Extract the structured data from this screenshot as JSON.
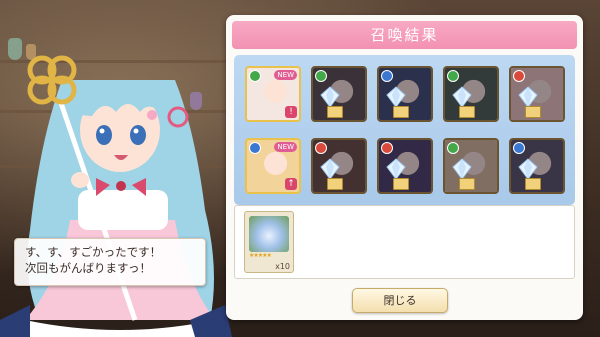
{
  "dialog": {
    "title": "召喚結果",
    "close_label": "閉じる"
  },
  "speech": {
    "line1": "す、す、すごかったです！",
    "line2": "次回もがんばりますっ！"
  },
  "results": [
    {
      "element": "wind",
      "elem_color": "#43a84a",
      "new": "NEW",
      "rare": true,
      "badge": "!",
      "crystal": false
    },
    {
      "element": "wind",
      "elem_color": "#43a84a",
      "new": "",
      "rare": false,
      "badge": "",
      "crystal": true
    },
    {
      "element": "water",
      "elem_color": "#3b78d1",
      "new": "",
      "rare": false,
      "badge": "",
      "crystal": true
    },
    {
      "element": "wind",
      "elem_color": "#43a84a",
      "new": "",
      "rare": false,
      "badge": "",
      "crystal": true
    },
    {
      "element": "fire",
      "elem_color": "#d94a3d",
      "new": "",
      "rare": false,
      "badge": "",
      "crystal": true
    },
    {
      "element": "water",
      "elem_color": "#3b78d1",
      "new": "NEW",
      "rare": true,
      "badge": "↑",
      "crystal": false
    },
    {
      "element": "fire",
      "elem_color": "#d94a3d",
      "new": "",
      "rare": false,
      "badge": "",
      "crystal": true
    },
    {
      "element": "fire",
      "elem_color": "#d94a3d",
      "new": "",
      "rare": false,
      "badge": "",
      "crystal": true
    },
    {
      "element": "wind",
      "elem_color": "#43a84a",
      "new": "",
      "rare": false,
      "badge": "",
      "crystal": true
    },
    {
      "element": "water",
      "elem_color": "#3b78d1",
      "new": "",
      "rare": false,
      "badge": "",
      "crystal": true
    }
  ],
  "bonus_item": {
    "icon": "crystal-bouquet-icon",
    "count": "x10"
  }
}
